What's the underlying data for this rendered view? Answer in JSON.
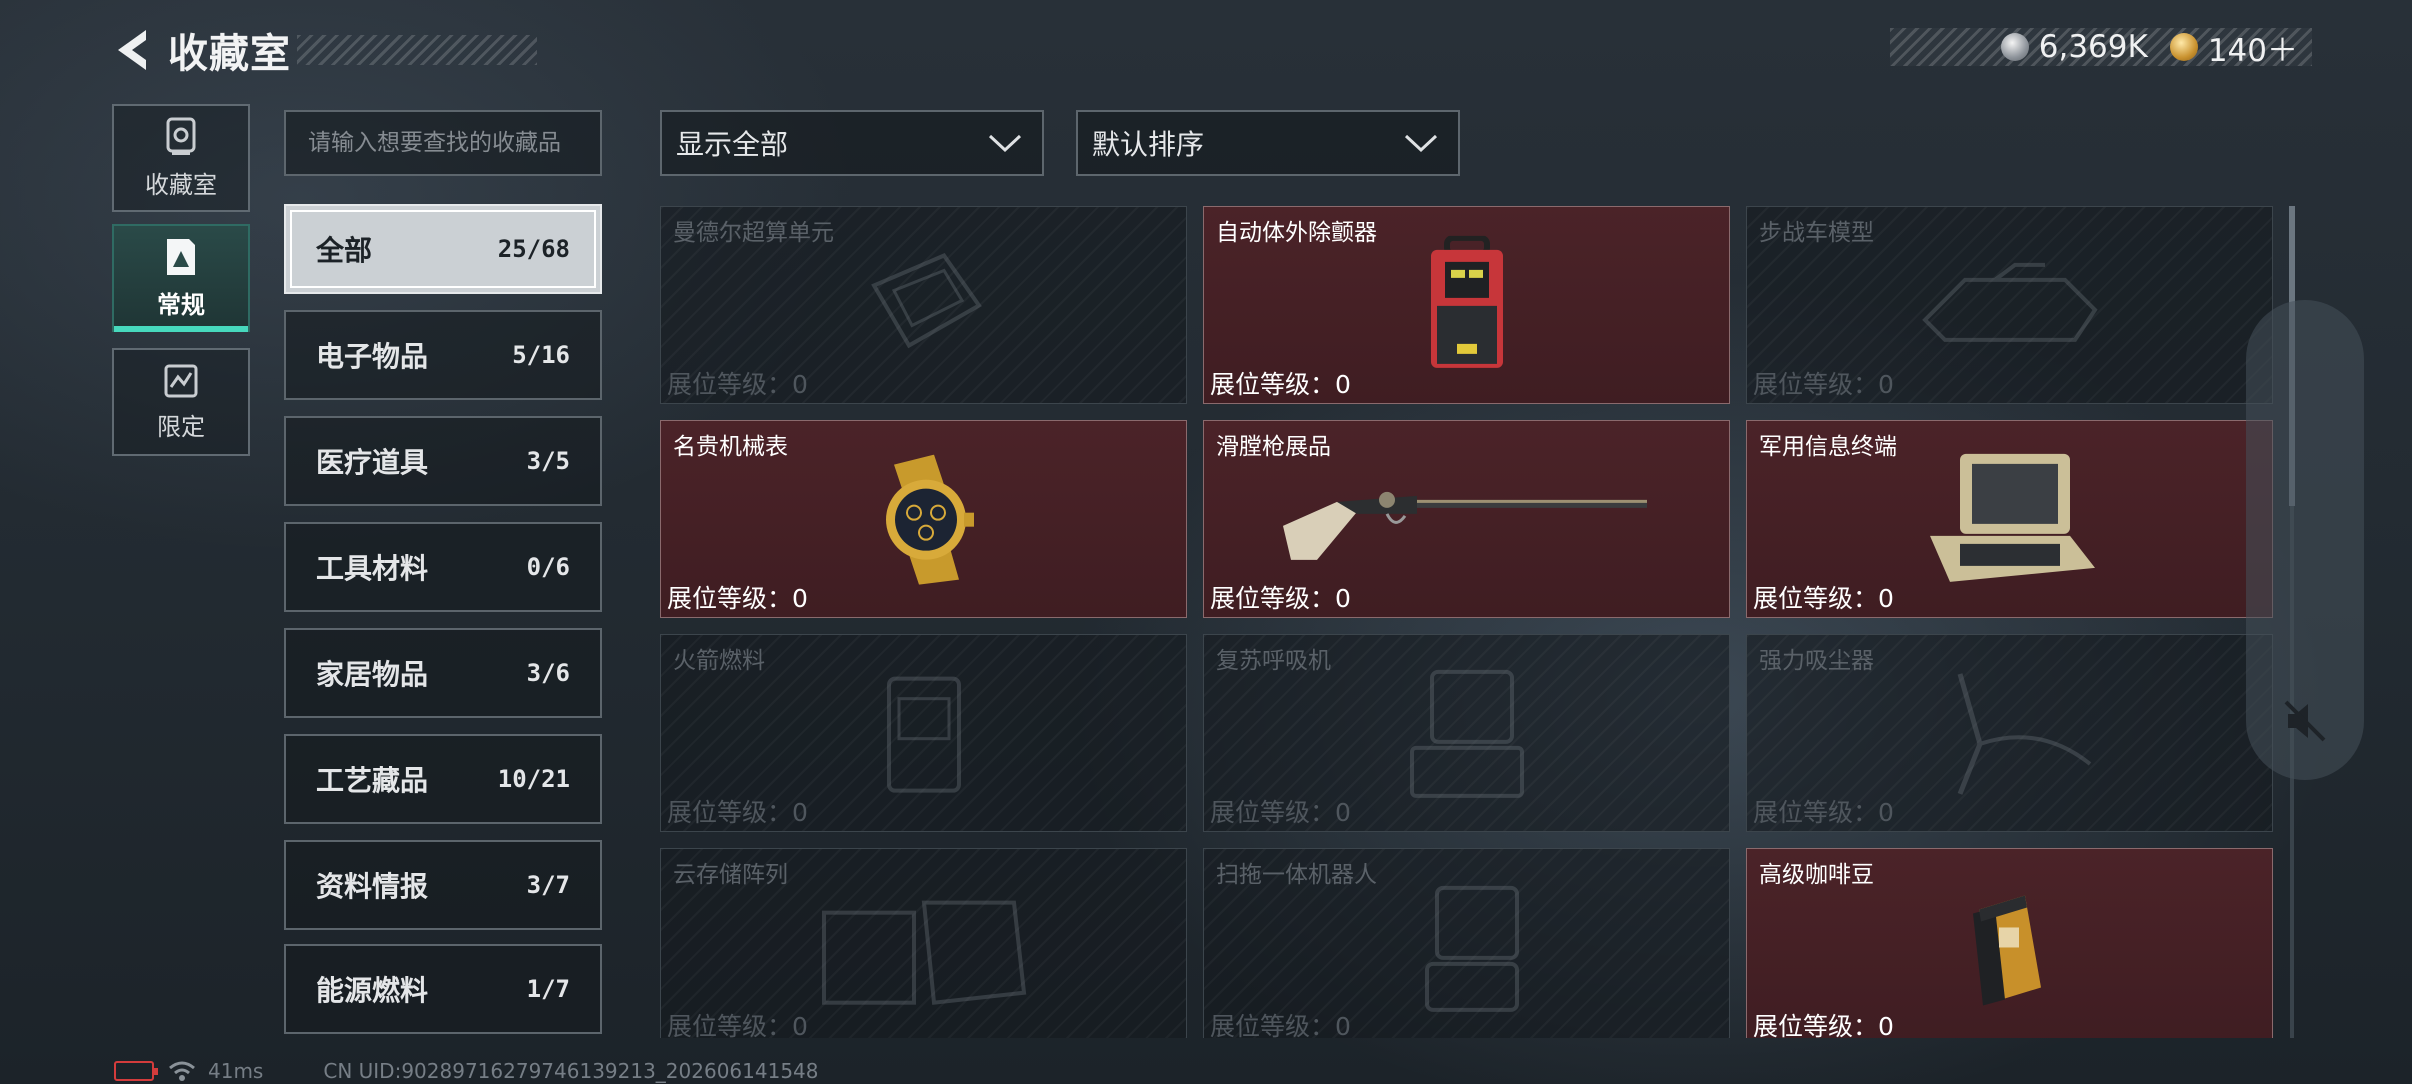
{
  "header": {
    "title": "收藏室"
  },
  "currency": [
    {
      "icon": "silver-coin-icon",
      "value": "6,369K"
    },
    {
      "icon": "gold-coin-icon",
      "value": "140＋"
    }
  ],
  "rail": [
    {
      "label": "收藏室",
      "icon": "showcase-icon",
      "active": false
    },
    {
      "label": "常规",
      "icon": "regular-card-icon",
      "active": true
    },
    {
      "label": "限定",
      "icon": "limited-card-icon",
      "active": false
    }
  ],
  "search": {
    "placeholder": "请输入想要查找的收藏品"
  },
  "categories": [
    {
      "name": "全部",
      "count": "25/68"
    },
    {
      "name": "电子物品",
      "count": "5/16"
    },
    {
      "name": "医疗道具",
      "count": "3/5"
    },
    {
      "name": "工具材料",
      "count": "0/6"
    },
    {
      "name": "家居物品",
      "count": "3/6"
    },
    {
      "name": "工艺藏品",
      "count": "10/21"
    },
    {
      "name": "资料情报",
      "count": "3/7"
    },
    {
      "name": "能源燃料",
      "count": "1/7"
    }
  ],
  "filters": {
    "display": "显示全部",
    "sort": "默认排序"
  },
  "items": [
    {
      "name": "曼德尔超算单元",
      "level": "展位等级：0",
      "owned": false,
      "icon": "supercomputer-unit-icon"
    },
    {
      "name": "自动体外除颤器",
      "level": "展位等级：0",
      "owned": true,
      "icon": "defibrillator-icon"
    },
    {
      "name": "步战车模型",
      "level": "展位等级：0",
      "owned": false,
      "icon": "ifv-model-icon"
    },
    {
      "name": "名贵机械表",
      "level": "展位等级：0",
      "owned": true,
      "icon": "luxury-watch-icon"
    },
    {
      "name": "滑膛枪展品",
      "level": "展位等级：0",
      "owned": true,
      "icon": "musket-icon"
    },
    {
      "name": "军用信息终端",
      "level": "展位等级：0",
      "owned": true,
      "icon": "military-terminal-icon"
    },
    {
      "name": "火箭燃料",
      "level": "展位等级：0",
      "owned": false,
      "icon": "rocket-fuel-icon"
    },
    {
      "name": "复苏呼吸机",
      "level": "展位等级：0",
      "owned": false,
      "icon": "ventilator-icon"
    },
    {
      "name": "强力吸尘器",
      "level": "展位等级：0",
      "owned": false,
      "icon": "vacuum-cleaner-icon"
    },
    {
      "name": "云存储阵列",
      "level": "展位等级：0",
      "owned": false,
      "icon": "storage-array-icon"
    },
    {
      "name": "扫拖一体机器人",
      "level": "展位等级：0",
      "owned": false,
      "icon": "robot-cleaner-icon"
    },
    {
      "name": "高级咖啡豆",
      "level": "展位等级：0",
      "owned": true,
      "icon": "coffee-beans-icon"
    }
  ],
  "status": {
    "ping": "41ms",
    "uid": "CN UID:902897162797461392​13_202606141548"
  },
  "colors": {
    "accent": "#47d9bd",
    "owned_card": "#4b2328",
    "battery_low": "#d43c3c"
  }
}
